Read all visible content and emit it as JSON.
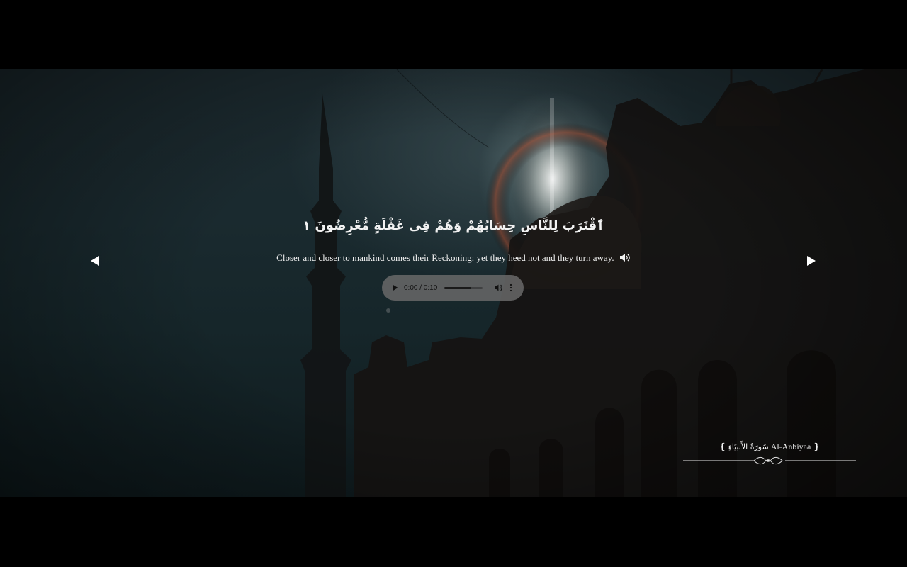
{
  "ayah": {
    "arabic": "ٱقْتَرَبَ لِلنَّاسِ حِسَابُهُمْ وَهُمْ فِى غَفْلَةٍ مُّعْرِضُونَ ١",
    "translation": "Closer and closer to mankind comes their Reckoning: yet they heed not and they turn away."
  },
  "audio": {
    "time": "0:00 / 0:10",
    "progress": 0.7
  },
  "surah": {
    "open_bracket": "❴",
    "close_bracket": "❵",
    "name_arabic": "سُورَةُ الأَنبيَاءِ",
    "name_english": "Al-Anbiyaa"
  },
  "icons": {
    "prev": "triangle-left-icon",
    "next": "triangle-right-icon",
    "speaker": "speaker-icon",
    "play": "play-icon",
    "volume": "volume-icon",
    "more": "more-vertical-icon"
  },
  "colors": {
    "text": "#f2f2f2",
    "background": "#1a2a2f",
    "player_bg": "#696969"
  }
}
